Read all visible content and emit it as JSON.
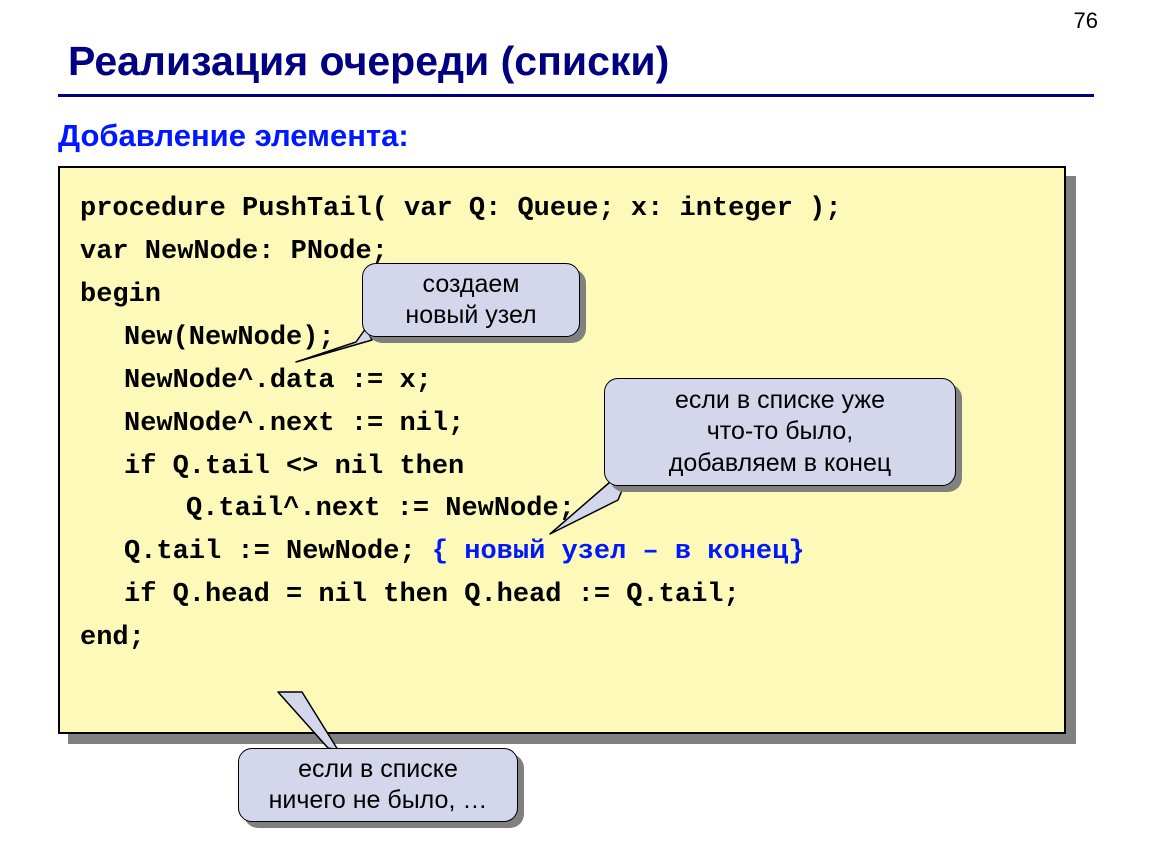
{
  "page_number": "76",
  "title": "Реализация очереди (списки)",
  "subtitle": "Добавление элемента:",
  "code": {
    "l1": "procedure PushTail( var Q: Queue; x: integer );",
    "l2": "var NewNode: PNode;",
    "l3": "begin",
    "l4": "New(NewNode);",
    "l5": "NewNode^.data := x;",
    "l6": "NewNode^.next := nil;",
    "l7": "if Q.tail <> nil then",
    "l8": "Q.tail^.next := NewNode;",
    "l9a": "Q.tail := NewNode; ",
    "l9b": "{ новый узел – в конец}",
    "l10": "if Q.head = nil then Q.head := Q.tail;",
    "l11": "end;"
  },
  "callouts": {
    "c1": "создаем\nновый узел",
    "c2": "если в списке уже\nчто-то было,\nдобавляем в конец",
    "c3": "если в списке\nничего не было, …"
  }
}
